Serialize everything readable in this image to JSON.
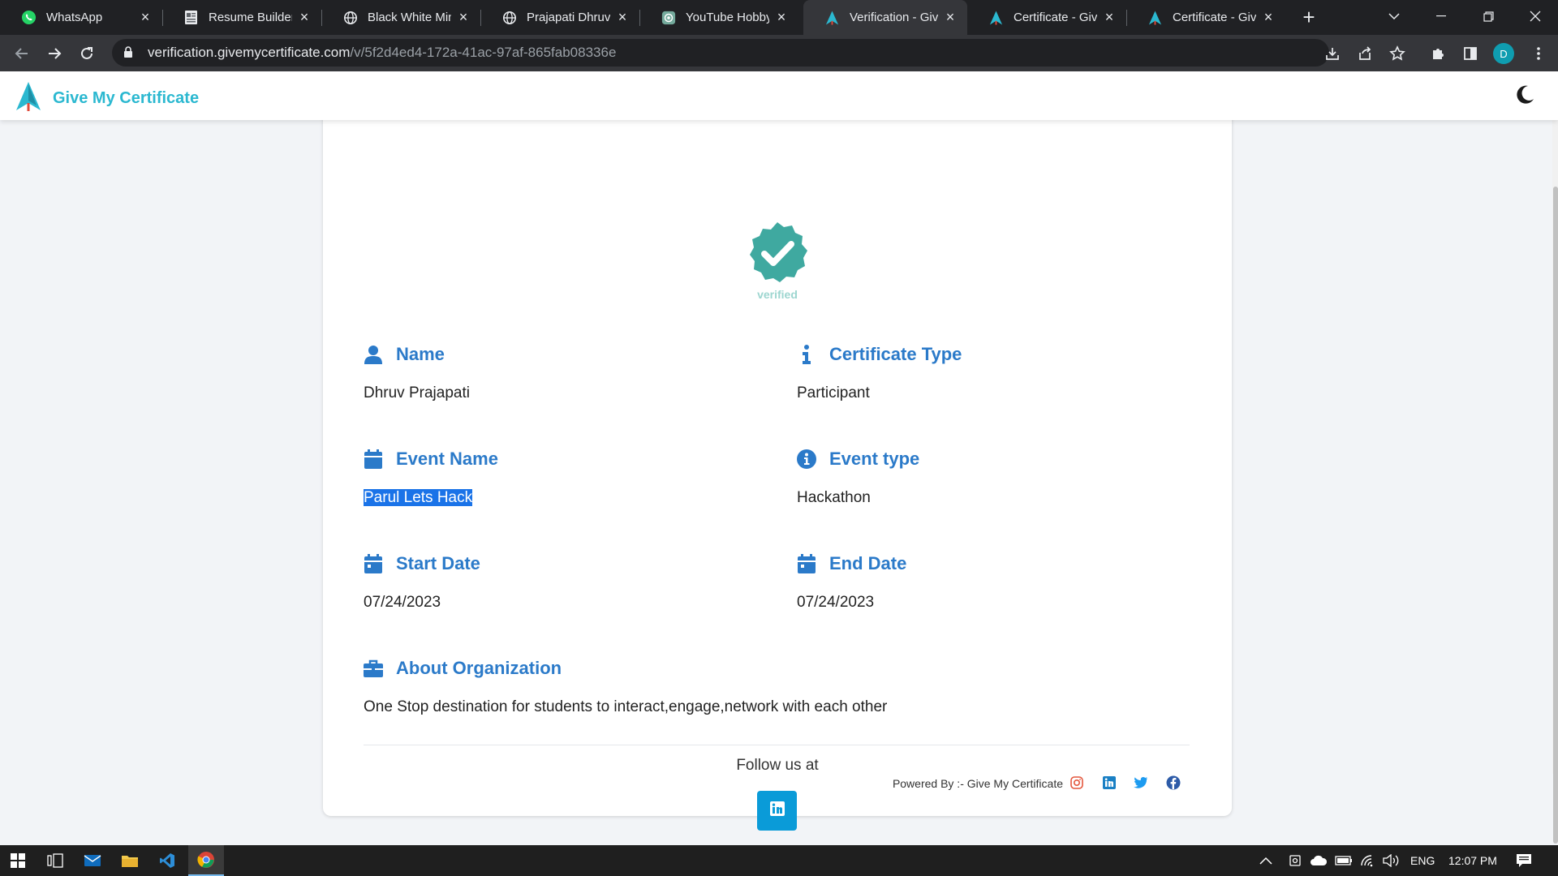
{
  "browser": {
    "tabs": [
      {
        "title": "WhatsApp",
        "icon": "whatsapp-icon",
        "active": false
      },
      {
        "title": "Resume Builder",
        "icon": "resume-icon",
        "active": false
      },
      {
        "title": "Black White Minir",
        "icon": "globe-icon",
        "active": false
      },
      {
        "title": "Prajapati Dhruvku",
        "icon": "globe-icon",
        "active": false
      },
      {
        "title": "YouTube Hobby i",
        "icon": "chatgpt-icon",
        "active": false
      },
      {
        "title": "Verification - Give",
        "icon": "gmc-logo-icon",
        "active": true
      },
      {
        "title": "Certificate - GiveM",
        "icon": "gmc-logo-icon",
        "active": false
      },
      {
        "title": "Certificate - GiveM",
        "icon": "gmc-logo-icon",
        "active": false
      }
    ],
    "url_host": "verification.givemycertificate.com",
    "url_path": "/v/5f2d4ed4-172a-41ac-97af-865fab08336e",
    "profile_initial": "D"
  },
  "site": {
    "brand": "Give My Certificate",
    "verified_text": "verified"
  },
  "certificate": {
    "name_label": "Name",
    "name_value": "Dhruv Prajapati",
    "cert_type_label": "Certificate Type",
    "cert_type_value": "Participant",
    "event_name_label": "Event Name",
    "event_name_value": "Parul Lets Hack",
    "event_type_label": "Event type",
    "event_type_value": "Hackathon",
    "start_date_label": "Start Date",
    "start_date_value": "07/24/2023",
    "end_date_label": "End Date",
    "end_date_value": "07/24/2023",
    "about_label": "About Organization",
    "about_value": "One Stop destination for students to interact,engage,network with each other"
  },
  "footer": {
    "follow_text": "Follow us at",
    "powered_text": "Powered By :- Give My Certificate"
  },
  "taskbar": {
    "language": "ENG",
    "time": "12:07 PM"
  },
  "colors": {
    "accent": "#2b7ac9",
    "brand": "#2bb8d0",
    "verified_badge": "#3fa9a0",
    "linkedin": "#0a9bd8"
  }
}
